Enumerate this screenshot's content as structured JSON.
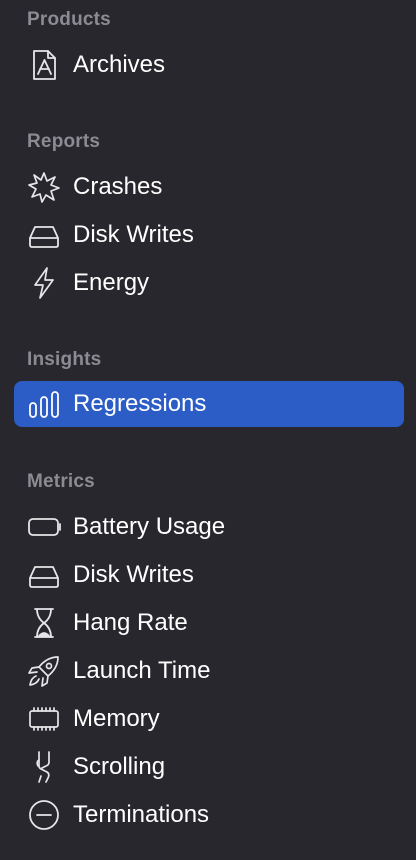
{
  "sidebar": {
    "sections": [
      {
        "header": "Products",
        "items": [
          {
            "label": "Archives",
            "icon": "archive-app-icon"
          }
        ]
      },
      {
        "header": "Reports",
        "items": [
          {
            "label": "Crashes",
            "icon": "crash-burst-icon"
          },
          {
            "label": "Disk Writes",
            "icon": "disk-drive-icon"
          },
          {
            "label": "Energy",
            "icon": "bolt-icon"
          }
        ]
      },
      {
        "header": "Insights",
        "items": [
          {
            "label": "Regressions",
            "icon": "bar-chart-icon",
            "selected": true
          }
        ]
      },
      {
        "header": "Metrics",
        "items": [
          {
            "label": "Battery Usage",
            "icon": "battery-icon"
          },
          {
            "label": "Disk Writes",
            "icon": "disk-drive-icon"
          },
          {
            "label": "Hang Rate",
            "icon": "hourglass-icon"
          },
          {
            "label": "Launch Time",
            "icon": "rocket-icon"
          },
          {
            "label": "Memory",
            "icon": "memory-chip-icon"
          },
          {
            "label": "Scrolling",
            "icon": "scroll-gesture-icon"
          },
          {
            "label": "Terminations",
            "icon": "minus-circle-icon"
          }
        ]
      }
    ]
  },
  "colors": {
    "background": "#29272e",
    "section_header": "#8d8b92",
    "selection": "#2c5cc5",
    "icon_stroke": "#e6e6e8",
    "text": "#ffffff"
  }
}
